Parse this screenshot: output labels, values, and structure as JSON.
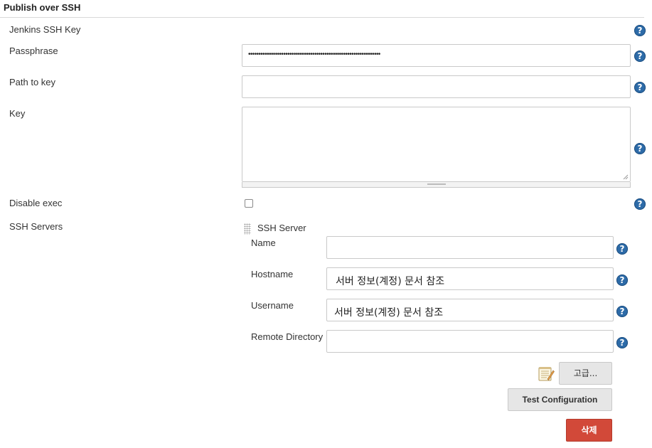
{
  "section": {
    "title": "Publish over SSH"
  },
  "fields": {
    "jenkins_ssh_key_label": "Jenkins SSH Key",
    "passphrase_label": "Passphrase",
    "passphrase_value": "••••••••••••••••••••••••••••••••••••••••••••••••••••••••••••••••",
    "path_to_key_label": "Path to key",
    "path_to_key_value": "",
    "key_label": "Key",
    "key_value": "",
    "disable_exec_label": "Disable exec",
    "disable_exec_checked": false,
    "ssh_servers_label": "SSH Servers"
  },
  "ssh_server": {
    "header": "SSH Server",
    "name_label": "Name",
    "name_value": "",
    "hostname_label": "Hostname",
    "hostname_value": "서버 정보(계정) 문서 참조",
    "username_label": "Username",
    "username_value": "서버 정보(계정) 문서 참조",
    "remote_directory_label": "Remote Directory",
    "remote_directory_value": ""
  },
  "buttons": {
    "advanced": "고급...",
    "test_configuration": "Test Configuration",
    "delete": "삭제"
  },
  "icons": {
    "help": "help-icon",
    "notepad": "notepad-icon",
    "drag": "drag-handle-icon"
  },
  "colors": {
    "help_icon": "#2d6ba8",
    "delete_button": "#d24939",
    "button_bg": "#e6e6e6",
    "input_border": "#c9c9c9"
  }
}
